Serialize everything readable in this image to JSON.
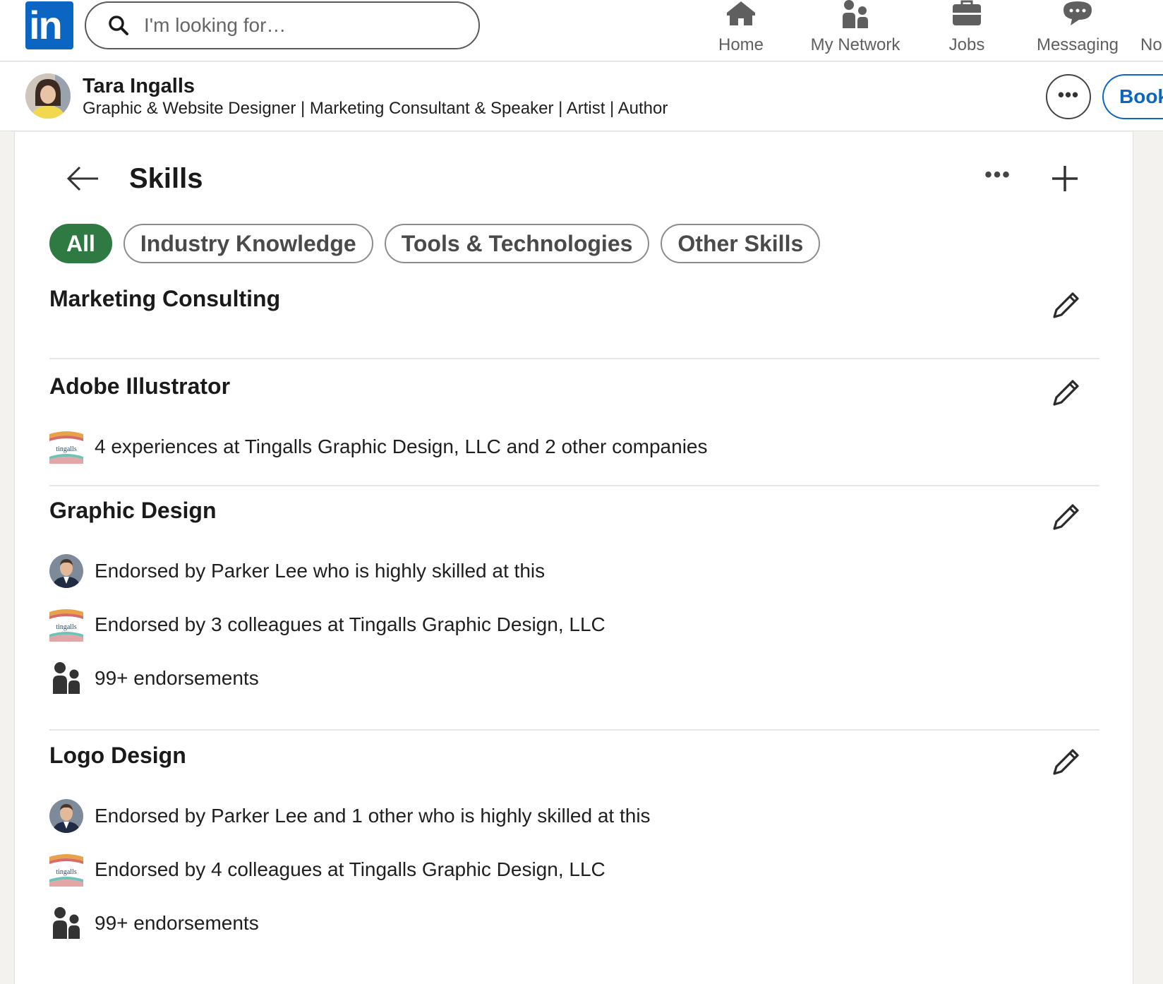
{
  "nav": {
    "logo_text": "in",
    "search_placeholder": "I'm looking for…",
    "items": [
      {
        "label": "Home",
        "icon": "home-icon"
      },
      {
        "label": "My Network",
        "icon": "network-icon"
      },
      {
        "label": "Jobs",
        "icon": "briefcase-icon"
      },
      {
        "label": "Messaging",
        "icon": "chat-icon"
      },
      {
        "label": "No",
        "icon": "bell-icon"
      }
    ]
  },
  "profile": {
    "name": "Tara Ingalls",
    "headline": "Graphic & Website Designer | Marketing Consultant & Speaker | Artist | Author",
    "more_label": "•••",
    "cta_label": "Book"
  },
  "section": {
    "title": "Skills",
    "more_label": "•••",
    "filters": [
      {
        "label": "All",
        "active": true
      },
      {
        "label": "Industry Knowledge",
        "active": false
      },
      {
        "label": "Tools & Technologies",
        "active": false
      },
      {
        "label": "Other Skills",
        "active": false
      }
    ]
  },
  "skills": [
    {
      "name": "Marketing Consulting",
      "rows": []
    },
    {
      "name": "Adobe Illustrator",
      "rows": [
        {
          "icon": "company-logo-icon",
          "text": "4 experiences at Tingalls Graphic Design, LLC and 2 other companies"
        }
      ]
    },
    {
      "name": "Graphic Design",
      "rows": [
        {
          "icon": "person-avatar",
          "text": "Endorsed by Parker Lee who is highly skilled at this"
        },
        {
          "icon": "company-logo-icon",
          "text": "Endorsed by 3 colleagues at Tingalls Graphic Design, LLC"
        },
        {
          "icon": "people-icon",
          "text": "99+ endorsements"
        }
      ]
    },
    {
      "name": "Logo Design",
      "rows": [
        {
          "icon": "person-avatar",
          "text": "Endorsed by Parker Lee and 1 other who is highly skilled at this"
        },
        {
          "icon": "company-logo-icon",
          "text": "Endorsed by 4 colleagues at Tingalls Graphic Design, LLC"
        },
        {
          "icon": "people-icon",
          "text": "99+ endorsements"
        }
      ]
    }
  ],
  "company_logo_text": "tingalls",
  "colors": {
    "brand": "#0a66c2",
    "active_filter": "#2f7a43",
    "nav_text": "#5f5f5f"
  }
}
